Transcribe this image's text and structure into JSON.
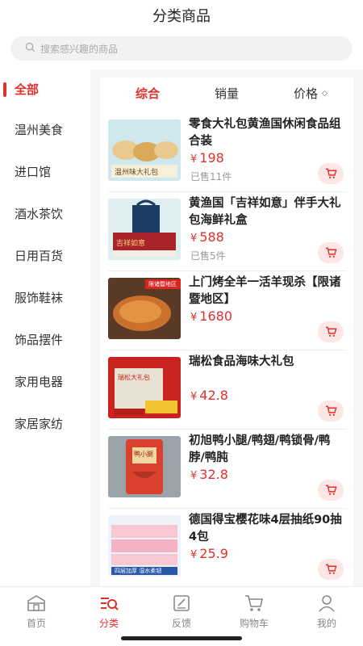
{
  "header": {
    "title": "分类商品"
  },
  "search": {
    "placeholder": "搜索感兴趣的商品"
  },
  "sidebar": {
    "items": [
      {
        "label": "全部",
        "active": true
      },
      {
        "label": "温州美食"
      },
      {
        "label": "进口馆"
      },
      {
        "label": "酒水茶饮"
      },
      {
        "label": "日用百货"
      },
      {
        "label": "服饰鞋袜"
      },
      {
        "label": "饰品摆件"
      },
      {
        "label": "家用电器"
      },
      {
        "label": "家居家纺"
      }
    ]
  },
  "sort": {
    "tabs": [
      {
        "label": "综合",
        "active": true
      },
      {
        "label": "销量"
      },
      {
        "label": "价格",
        "icon": "sort-toggle-icon"
      }
    ]
  },
  "products": [
    {
      "title": "零食大礼包黄渔国休闲食品组合装",
      "currency": "¥",
      "price": "198",
      "sold": "已售11件",
      "thumb_text": "温州味大礼包"
    },
    {
      "title": "黄渔国「吉祥如意」伴手大礼包海鲜礼盒",
      "currency": "¥",
      "price": "588",
      "sold": "已售5件",
      "thumb_text": "吉祥如意"
    },
    {
      "title": "上门烤全羊一活羊现杀【限诸暨地区】",
      "currency": "¥",
      "price": "1680",
      "thumb_text": "限诸暨地区"
    },
    {
      "title": "瑞松食品海味大礼包",
      "currency": "¥",
      "price": "42.8",
      "thumb_text": "瑞松大礼包"
    },
    {
      "title": "初旭鸭小腿/鸭翅/鸭锁骨/鸭脖/鸭肫",
      "currency": "¥",
      "price": "32.8",
      "thumb_text": "鸭小腿"
    },
    {
      "title": "德国得宝樱花味4层抽纸90抽4包",
      "currency": "¥",
      "price": "25.9",
      "thumb_text": "四层加厚 湿水柔韧"
    }
  ],
  "tabbar": {
    "items": [
      {
        "label": "首页",
        "icon": "home-icon"
      },
      {
        "label": "分类",
        "icon": "category-icon",
        "active": true
      },
      {
        "label": "反馈",
        "icon": "feedback-icon"
      },
      {
        "label": "购物车",
        "icon": "cart-icon"
      },
      {
        "label": "我的",
        "icon": "profile-icon"
      }
    ]
  },
  "colors": {
    "accent": "#e0302b",
    "cart_bg": "#fde6e6",
    "page_bg": "#f5f5f5"
  }
}
